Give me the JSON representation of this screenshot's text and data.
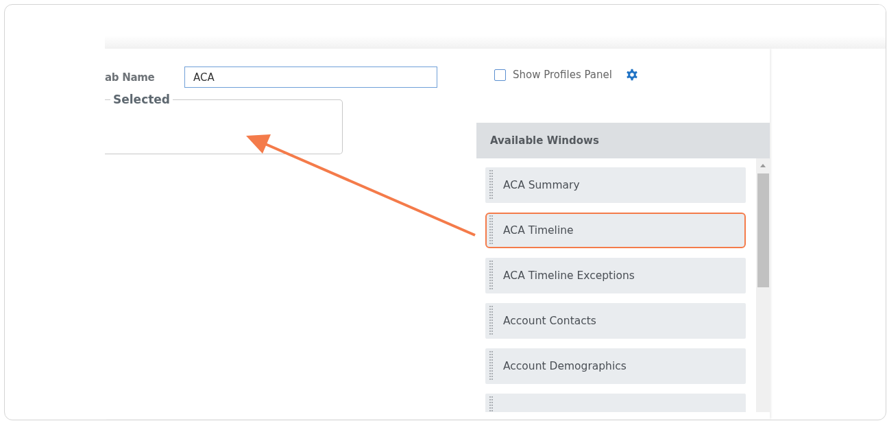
{
  "tab_name": {
    "label": "ab Name",
    "value": "ACA"
  },
  "selected_group": {
    "legend": "Selected"
  },
  "show_profiles_panel": {
    "label": "Show Profiles Panel",
    "checked": false
  },
  "available_windows": {
    "title": "Available Windows",
    "items": [
      {
        "label": "ACA Summary",
        "highlighted": false
      },
      {
        "label": "ACA Timeline",
        "highlighted": true
      },
      {
        "label": "ACA Timeline Exceptions",
        "highlighted": false
      },
      {
        "label": "Account Contacts",
        "highlighted": false
      },
      {
        "label": "Account Demographics",
        "highlighted": false
      },
      {
        "highlighted": false
      }
    ]
  }
}
